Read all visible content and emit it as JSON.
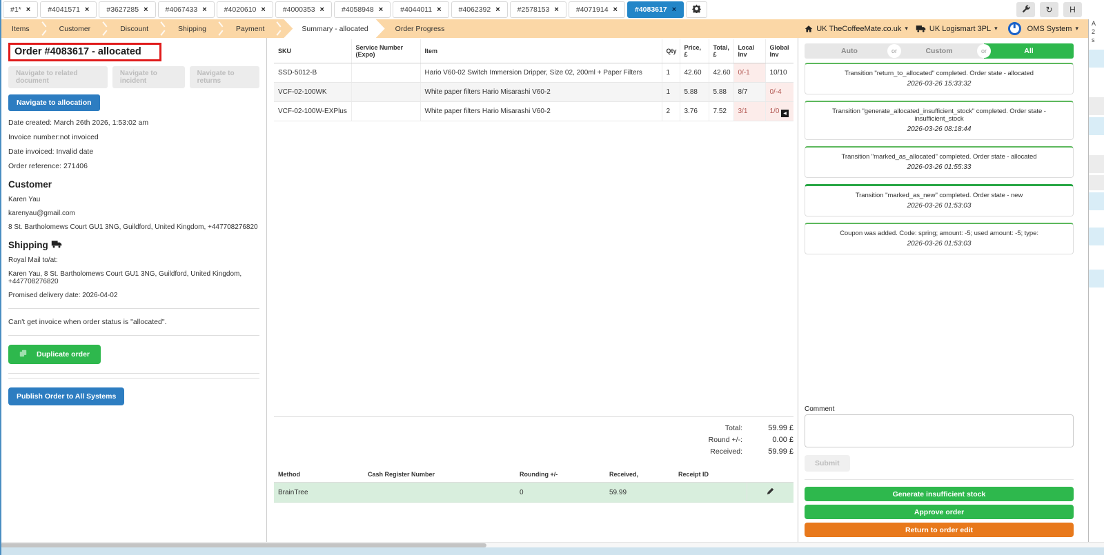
{
  "icons": {
    "close": "×",
    "caret_down": "▾",
    "refresh": "↻",
    "collapse_left": "◀"
  },
  "tabs": {
    "items": [
      "#1*",
      "#4041571",
      "#3627285",
      "#4067433",
      "#4020610",
      "#4000353",
      "#4058948",
      "#4044011",
      "#4062392",
      "#2578153",
      "#4071914",
      "#4083617"
    ],
    "active": "#4083617",
    "h_button": "H"
  },
  "navbar": {
    "steps": [
      "Items",
      "Customer",
      "Discount",
      "Shipping",
      "Payment",
      "Summary - allocated",
      "Order Progress"
    ],
    "active_step": "Summary - allocated",
    "store": "UK TheCoffeeMate.co.uk",
    "warehouse": "UK Logismart 3PL",
    "system": "OMS System"
  },
  "order_panel": {
    "title": "Order #4083617 - allocated",
    "disabled_buttons": [
      "Navigate to related document",
      "Navigate to incident",
      "Navigate to returns"
    ],
    "allocation_button": "Navigate to allocation",
    "meta": [
      "Date created: March 26th 2026, 1:53:02 am",
      "Invoice number:not invoiced",
      "Date invoiced: Invalid date",
      "Order reference: 271406"
    ],
    "customer": {
      "heading": "Customer",
      "name": "Karen Yau",
      "email": "karenyau@gmail.com",
      "address": "8 St. Bartholomews Court GU1 3NG, Guildford, United Kingdom, +447708276820"
    },
    "shipping": {
      "heading": "Shipping",
      "carrier": "Royal Mail to/at:",
      "address": "Karen Yau, 8 St. Bartholomews Court GU1 3NG, Guildford, United Kingdom, +447708276820",
      "promised": "Promised delivery date: 2026-04-02"
    },
    "invoice_note": "Can't get invoice when order status is \"allocated\".",
    "duplicate_button": "Duplicate order",
    "publish_button": "Publish Order to All Systems"
  },
  "items_table": {
    "headers": [
      "SKU",
      "Service Number (Expo)",
      "Item",
      "Qty",
      "Price, £",
      "Total, £",
      "Local Inv",
      "Global Inv"
    ],
    "rows": [
      {
        "sku": "SSD-5012-B",
        "service": "",
        "item": "Hario V60-02 Switch Immersion Dripper, Size 02, 200ml + Paper Filters",
        "qty": "1",
        "price": "42.60",
        "total": "42.60",
        "local": "0/-1",
        "global": "10/10"
      },
      {
        "sku": "VCF-02-100WK",
        "service": "",
        "item": "White paper filters Hario Misarashi V60-2",
        "qty": "1",
        "price": "5.88",
        "total": "5.88",
        "local": "8/7",
        "global": "0/-4"
      },
      {
        "sku": "VCF-02-100W-EXPlus",
        "service": "",
        "item": "White paper filters Hario Misarashi V60-2",
        "qty": "2",
        "price": "3.76",
        "total": "7.52",
        "local": "3/1",
        "global": "1/0"
      }
    ]
  },
  "totals": {
    "rows": [
      {
        "label": "Total:",
        "value": "59.99 £"
      },
      {
        "label": "Round +/-:",
        "value": "0.00 £"
      },
      {
        "label": "Received:",
        "value": "59.99 £"
      }
    ]
  },
  "payment_table": {
    "headers": [
      "Method",
      "Cash Register Number",
      "Rounding +/-",
      "Received,",
      "Receipt ID"
    ],
    "row": {
      "method": "BrainTree",
      "cash_register": "",
      "rounding": "0",
      "received": "59.99",
      "receipt_id": ""
    }
  },
  "history_panel": {
    "filter": {
      "options": [
        "Auto",
        "Custom",
        "All"
      ],
      "separator": "or",
      "active": "All"
    },
    "events": [
      {
        "text": "Transition \"return_to_allocated\" completed. Order state - allocated",
        "time": "2026-03-26 15:33:32"
      },
      {
        "text": "Transition \"generate_allocated_insufficient_stock\" completed. Order state - insufficient_stock",
        "time": "2026-03-26 08:18:44"
      },
      {
        "text": "Transition \"marked_as_allocated\" completed. Order state - allocated",
        "time": "2026-03-26 01:55:33"
      },
      {
        "text": "Transition \"marked_as_new\" completed. Order state - new",
        "time": "2026-03-26 01:53:03"
      },
      {
        "text": "Coupon was added. Code: spring; amount: -5; used amount: -5; type:",
        "time": "2026-03-26 01:53:03"
      }
    ],
    "comment_label": "Comment",
    "submit_label": "Submit",
    "actions": [
      "Generate insufficient stock",
      "Approve order",
      "Return to order edit"
    ]
  },
  "edge_fragments": [
    "A",
    "2",
    "s"
  ]
}
